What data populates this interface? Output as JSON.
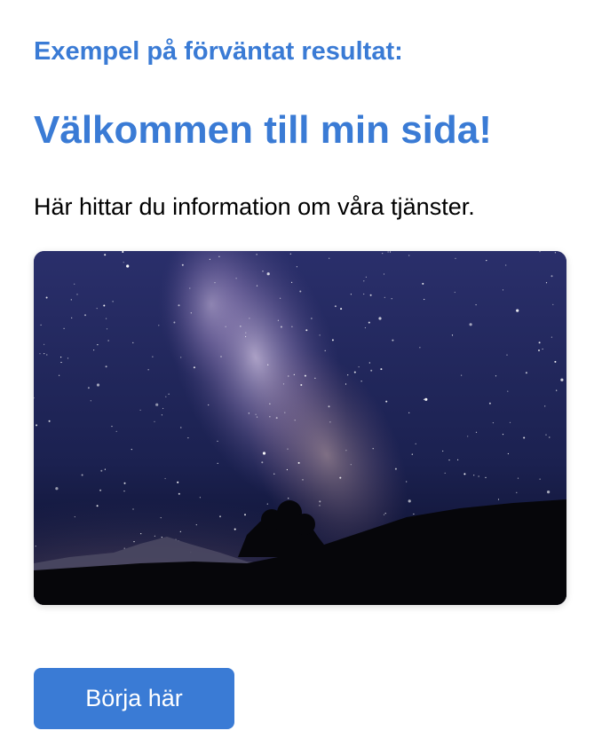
{
  "example_heading": "Exempel på förväntat resultat:",
  "main_title": "Välkommen till min sida!",
  "intro_text": "Här hittar du information om våra tjänster.",
  "hero_image": {
    "subject": "night sky with milky way over mountain silhouette and tree"
  },
  "cta": {
    "label": "Börja här"
  },
  "colors": {
    "accent": "#3a7bd5",
    "text": "#000000",
    "background": "#ffffff"
  }
}
